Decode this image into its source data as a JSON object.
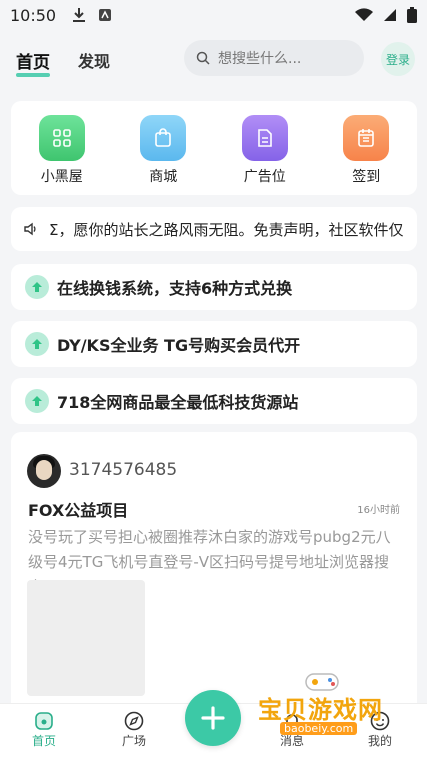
{
  "status_bar": {
    "time": "10:50"
  },
  "header": {
    "tabs": [
      {
        "label": "首页"
      },
      {
        "label": "发现"
      }
    ],
    "search_placeholder": "想搜些什么...",
    "login_label": "登录"
  },
  "quick_grid": [
    {
      "label": "小黑屋",
      "icon": "grid-icon",
      "color": "#4cd07d"
    },
    {
      "label": "商城",
      "icon": "shopping-bag-icon",
      "color": "#6cc4f2"
    },
    {
      "label": "广告位",
      "icon": "document-icon",
      "color": "#9c78f0"
    },
    {
      "label": "签到",
      "icon": "calendar-icon",
      "color": "#f9935a"
    }
  ],
  "marquee": {
    "text": "Σ，愿你的站长之路风雨无阻。免责声明，社区软件仅"
  },
  "promos": [
    {
      "text": "在线换钱系统，支持6种方式兑换"
    },
    {
      "text": "DY/KS全业务 TG号购买会员代开"
    },
    {
      "text": "718全网商品最全最低科技货源站"
    }
  ],
  "post": {
    "username": "3174576485",
    "title": "FOX公益项目",
    "time": "16小时前",
    "body": "没号玩了买号担心被圈推荐沐白家的游戏号pubg2元八级号4元TG飞机号直登号-V区扫码号提号地址浏览器搜索"
  },
  "bottom_nav": [
    {
      "label": "首页"
    },
    {
      "label": "广场"
    },
    {
      "label": "消息"
    },
    {
      "label": "我的"
    }
  ],
  "watermark": {
    "cn": "宝贝游戏网",
    "en": "baobeiy.com"
  },
  "colors": {
    "accent": "#2aae8a",
    "fab": "#3cc9a6"
  }
}
